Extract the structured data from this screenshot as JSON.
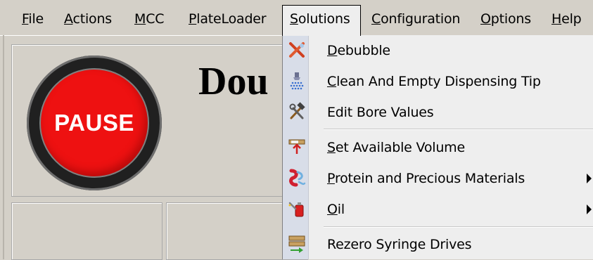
{
  "menubar": {
    "items": [
      {
        "label": "File",
        "mnemonic": "F"
      },
      {
        "label": "Actions",
        "mnemonic": "A"
      },
      {
        "label": "MCC",
        "mnemonic": "M"
      },
      {
        "label": "PlateLoader",
        "mnemonic": "P"
      },
      {
        "label": "Solutions",
        "mnemonic": "S",
        "open": true
      },
      {
        "label": "Configuration",
        "mnemonic": "C"
      },
      {
        "label": "Options",
        "mnemonic": "O"
      },
      {
        "label": "Help",
        "mnemonic": "H"
      }
    ]
  },
  "main": {
    "pause_label": "PAUSE",
    "title_partial": "Dou",
    "colors": {
      "pause_red": "#ee1111",
      "ring": "#202020"
    }
  },
  "solutions_menu": {
    "items": [
      {
        "label": "Debubble",
        "icon": "debubble-x-icon",
        "submenu": false
      },
      {
        "label": "Clean And Empty Dispensing Tip",
        "icon": "dispensing-tip-spray-icon",
        "submenu": false
      },
      {
        "label": "Edit Bore Values",
        "icon": "tools-hammer-icon",
        "submenu": false
      },
      {
        "label": "Set Available Volume",
        "icon": "syringe-volume-icon",
        "submenu": false
      },
      {
        "label": "Protein and Precious Materials",
        "icon": "protein-ribbon-icon",
        "submenu": true
      },
      {
        "label": "Oil",
        "icon": "oil-can-icon",
        "submenu": true
      },
      {
        "label": "Rezero Syringe Drives",
        "icon": "syringe-drive-icon",
        "submenu": false
      }
    ]
  }
}
